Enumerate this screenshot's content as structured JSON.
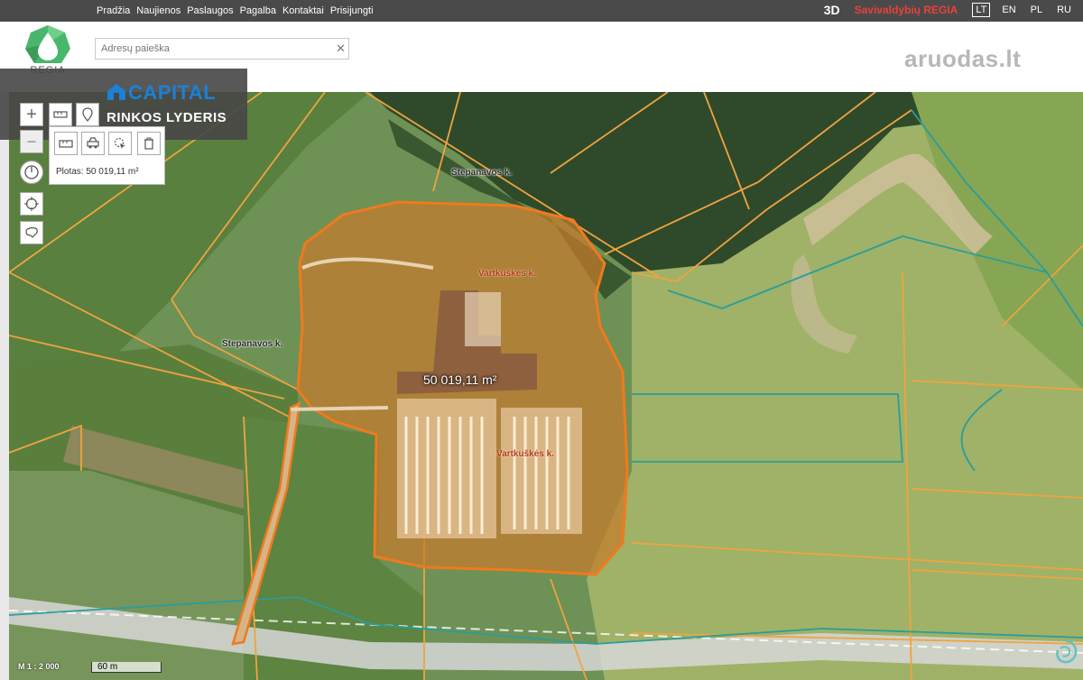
{
  "nav": {
    "links": [
      "Pradžia",
      "Naujienos",
      "Paslaugos",
      "Pagalba",
      "Kontaktai",
      "Prisijungti"
    ],
    "mode_3d": "3D",
    "brand": "Savivaldybių REGIA",
    "languages": [
      "LT",
      "EN",
      "PL",
      "RU"
    ],
    "active_language": "LT"
  },
  "header": {
    "logo_text": "REGIA",
    "search_placeholder": "Adresų paieška",
    "watermark": "aruodas.lt"
  },
  "banner": {
    "brand": "CAPITAL",
    "tagline": "RINKOS LYDERIS"
  },
  "tools": {
    "area_label": "Plotas: 50 019,11 m²"
  },
  "map": {
    "labels": {
      "stepanavos_top": "Stepanavos k.",
      "stepanavos_left": "Stepanavos k.",
      "vartkuskes_top": "Vartkuškės k.",
      "vartkuskes_bottom": "Vartkuškės k.",
      "area": "50 019,11 m²"
    },
    "scale": "M 1 : 2 000",
    "scalebar": "60 m",
    "parcel_color": "#f0891f",
    "boundary_color": "#f0a340",
    "teal_color": "#2a9d9a"
  }
}
